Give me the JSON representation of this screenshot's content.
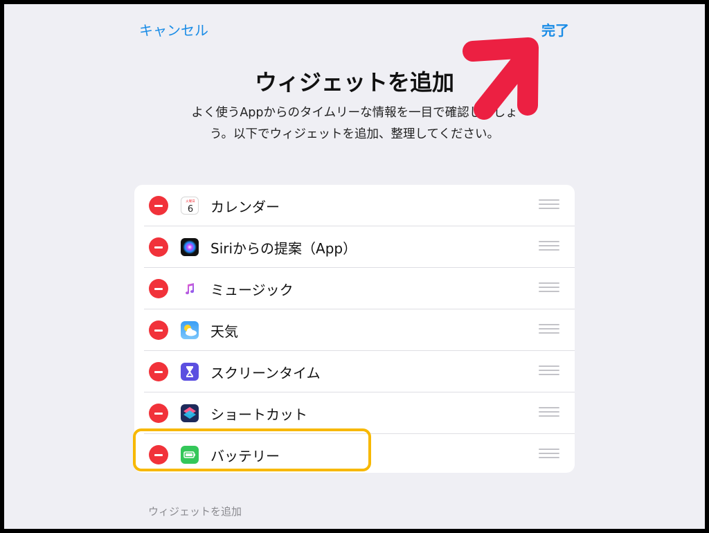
{
  "nav": {
    "cancel_label": "キャンセル",
    "done_label": "完了"
  },
  "header": {
    "title": "ウィジェットを追加",
    "description_line1": "よく使うAppからのタイムリーな情報を一目で確認しましょ",
    "description_line2": "う。以下でウィジェットを追加、整理してください。"
  },
  "widgets": [
    {
      "label": "カレンダー",
      "icon": "calendar-icon",
      "calendar_day": "6",
      "calendar_weekday": "火曜日"
    },
    {
      "label": "Siriからの提案（App）",
      "icon": "siri-icon"
    },
    {
      "label": "ミュージック",
      "icon": "music-icon"
    },
    {
      "label": "天気",
      "icon": "weather-icon"
    },
    {
      "label": "スクリーンタイム",
      "icon": "screen-time-icon"
    },
    {
      "label": "ショートカット",
      "icon": "shortcuts-icon"
    },
    {
      "label": "バッテリー",
      "icon": "battery-icon"
    }
  ],
  "add_section": {
    "header": "ウィジェットを追加"
  },
  "annotation": {
    "highlight_color": "#f7b800",
    "arrow_color": "#ec2042"
  },
  "colors": {
    "accent": "#1a8ce6",
    "delete": "#f1323a",
    "background": "#efeff4"
  }
}
